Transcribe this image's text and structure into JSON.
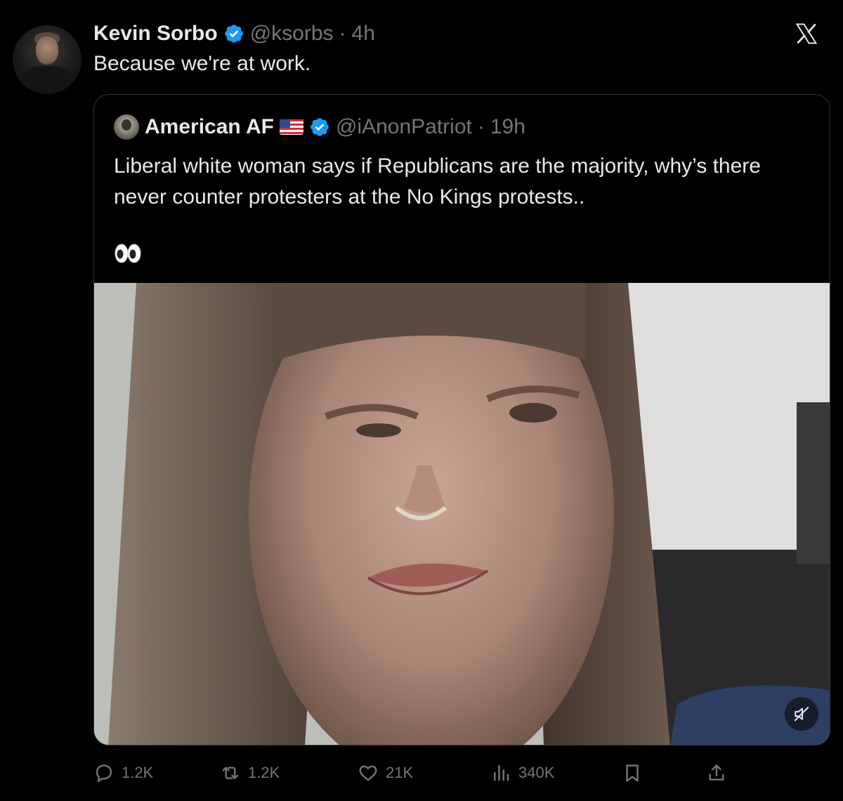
{
  "tweet": {
    "author_name": "Kevin Sorbo",
    "handle": "@ksorbs",
    "separator": "·",
    "time": "4h",
    "text": "Because we're at work."
  },
  "quoted_tweet": {
    "author_name": "American AF",
    "handle": "@iAnonPatriot",
    "separator": "·",
    "time": "19h",
    "text": "Liberal white woman says if Republicans are the majority, why’s there never counter protesters at the No Kings protests..",
    "emoji": "👀"
  },
  "actions": {
    "replies": "1.2K",
    "reposts": "1.2K",
    "likes": "21K",
    "views": "340K"
  },
  "colors": {
    "background": "#000000",
    "text_primary": "#e7e9ea",
    "text_secondary": "#71767b",
    "verified_blue": "#1d9bf0",
    "border": "#2f3336"
  },
  "icons": [
    "x-logo-icon",
    "verified-badge-icon",
    "us-flag-icon",
    "eyes-emoji",
    "mute-icon",
    "reply-icon",
    "repost-icon",
    "like-icon",
    "views-icon",
    "bookmark-icon",
    "share-icon"
  ]
}
